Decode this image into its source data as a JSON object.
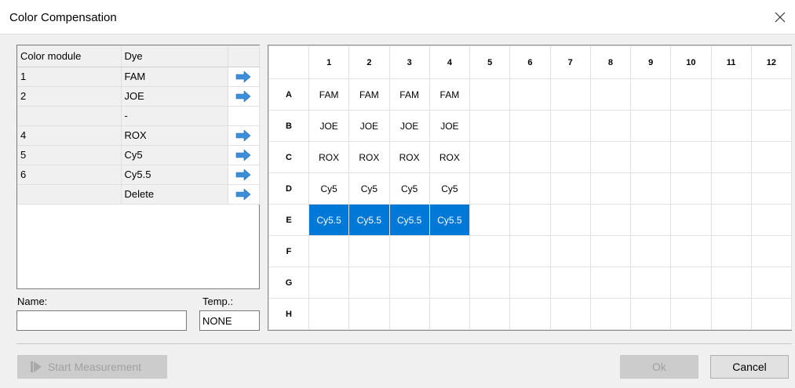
{
  "window": {
    "title": "Color Compensation"
  },
  "dye_table": {
    "headers": {
      "module": "Color module",
      "dye": "Dye"
    },
    "rows": [
      {
        "module": "1",
        "dye": "FAM",
        "arrow": true
      },
      {
        "module": "2",
        "dye": "JOE",
        "arrow": true
      },
      {
        "module": "",
        "dye": "-",
        "arrow": false
      },
      {
        "module": "4",
        "dye": "ROX",
        "arrow": true
      },
      {
        "module": "5",
        "dye": "Cy5",
        "arrow": true
      },
      {
        "module": "6",
        "dye": "Cy5.5",
        "arrow": true
      },
      {
        "module": "",
        "dye": "Delete",
        "arrow": true
      }
    ],
    "arrow_icon": "right-arrow-icon",
    "arrow_color": "#3a8fd8"
  },
  "fields": {
    "name_label": "Name:",
    "name_value": "",
    "temp_label": "Temp.:",
    "temp_value": "NONE"
  },
  "plate": {
    "columns": [
      "1",
      "2",
      "3",
      "4",
      "5",
      "6",
      "7",
      "8",
      "9",
      "10",
      "11",
      "12"
    ],
    "rows": [
      {
        "label": "A",
        "cells": [
          "FAM",
          "FAM",
          "FAM",
          "FAM",
          "",
          "",
          "",
          "",
          "",
          "",
          "",
          ""
        ]
      },
      {
        "label": "B",
        "cells": [
          "JOE",
          "JOE",
          "JOE",
          "JOE",
          "",
          "",
          "",
          "",
          "",
          "",
          "",
          ""
        ]
      },
      {
        "label": "C",
        "cells": [
          "ROX",
          "ROX",
          "ROX",
          "ROX",
          "",
          "",
          "",
          "",
          "",
          "",
          "",
          ""
        ]
      },
      {
        "label": "D",
        "cells": [
          "Cy5",
          "Cy5",
          "Cy5",
          "Cy5",
          "",
          "",
          "",
          "",
          "",
          "",
          "",
          ""
        ]
      },
      {
        "label": "E",
        "cells": [
          "Cy5.5",
          "Cy5.5",
          "Cy5.5",
          "Cy5.5",
          "",
          "",
          "",
          "",
          "",
          "",
          "",
          ""
        ],
        "selected": [
          0,
          1,
          2,
          3
        ]
      },
      {
        "label": "F",
        "cells": [
          "",
          "",
          "",
          "",
          "",
          "",
          "",
          "",
          "",
          "",
          "",
          ""
        ]
      },
      {
        "label": "G",
        "cells": [
          "",
          "",
          "",
          "",
          "",
          "",
          "",
          "",
          "",
          "",
          "",
          ""
        ]
      },
      {
        "label": "H",
        "cells": [
          "",
          "",
          "",
          "",
          "",
          "",
          "",
          "",
          "",
          "",
          "",
          ""
        ]
      }
    ],
    "selection_color": "#0078d7"
  },
  "buttons": {
    "start_measurement": "Start Measurement",
    "ok": "Ok",
    "cancel": "Cancel"
  }
}
